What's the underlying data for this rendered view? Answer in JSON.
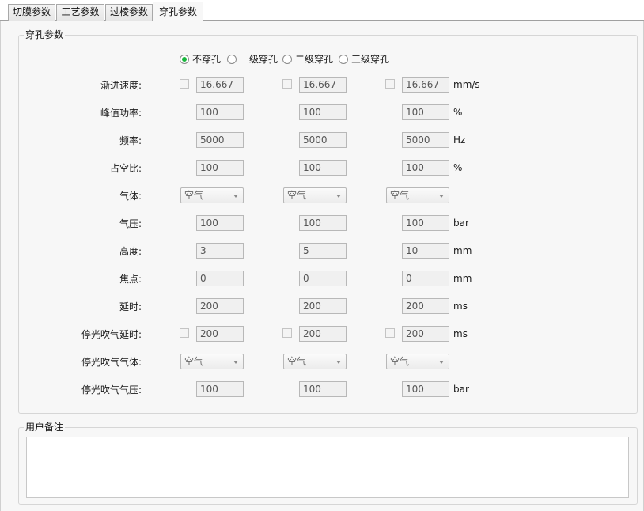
{
  "tabs": [
    {
      "label": "切膜参数"
    },
    {
      "label": "工艺参数"
    },
    {
      "label": "过棱参数"
    },
    {
      "label": "穿孔参数"
    }
  ],
  "piercing_group": {
    "title": "穿孔参数",
    "radios": [
      {
        "label": "不穿孔",
        "checked": true
      },
      {
        "label": "一级穿孔",
        "checked": false
      },
      {
        "label": "二级穿孔",
        "checked": false
      },
      {
        "label": "三级穿孔",
        "checked": false
      }
    ],
    "rows": [
      {
        "label": "渐进速度:",
        "values": [
          "16.667",
          "16.667",
          "16.667"
        ],
        "unit": "mm/s",
        "has_checkbox": true
      },
      {
        "label": "峰值功率:",
        "values": [
          "100",
          "100",
          "100"
        ],
        "unit": "%"
      },
      {
        "label": "频率:",
        "values": [
          "5000",
          "5000",
          "5000"
        ],
        "unit": "Hz"
      },
      {
        "label": "占空比:",
        "values": [
          "100",
          "100",
          "100"
        ],
        "unit": "%"
      },
      {
        "label": "气体:",
        "values": [
          "空气",
          "空气",
          "空气"
        ],
        "unit": "",
        "is_select": true
      },
      {
        "label": "气压:",
        "values": [
          "100",
          "100",
          "100"
        ],
        "unit": "bar"
      },
      {
        "label": "高度:",
        "values": [
          "3",
          "5",
          "10"
        ],
        "unit": "mm"
      },
      {
        "label": "焦点:",
        "values": [
          "0",
          "0",
          "0"
        ],
        "unit": "mm"
      },
      {
        "label": "延时:",
        "values": [
          "200",
          "200",
          "200"
        ],
        "unit": "ms"
      },
      {
        "label": "停光吹气延时:",
        "values": [
          "200",
          "200",
          "200"
        ],
        "unit": "ms",
        "has_checkbox": true
      },
      {
        "label": "停光吹气气体:",
        "values": [
          "空气",
          "空气",
          "空气"
        ],
        "unit": "",
        "is_select": true
      },
      {
        "label": "停光吹气气压:",
        "values": [
          "100",
          "100",
          "100"
        ],
        "unit": "bar"
      }
    ]
  },
  "notes_group": {
    "title": "用户备注",
    "text": ""
  },
  "colors": {
    "radio_selected": "#16b53b",
    "panel_bg": "#f7f7f7",
    "field_bg": "#f0f0f0"
  }
}
